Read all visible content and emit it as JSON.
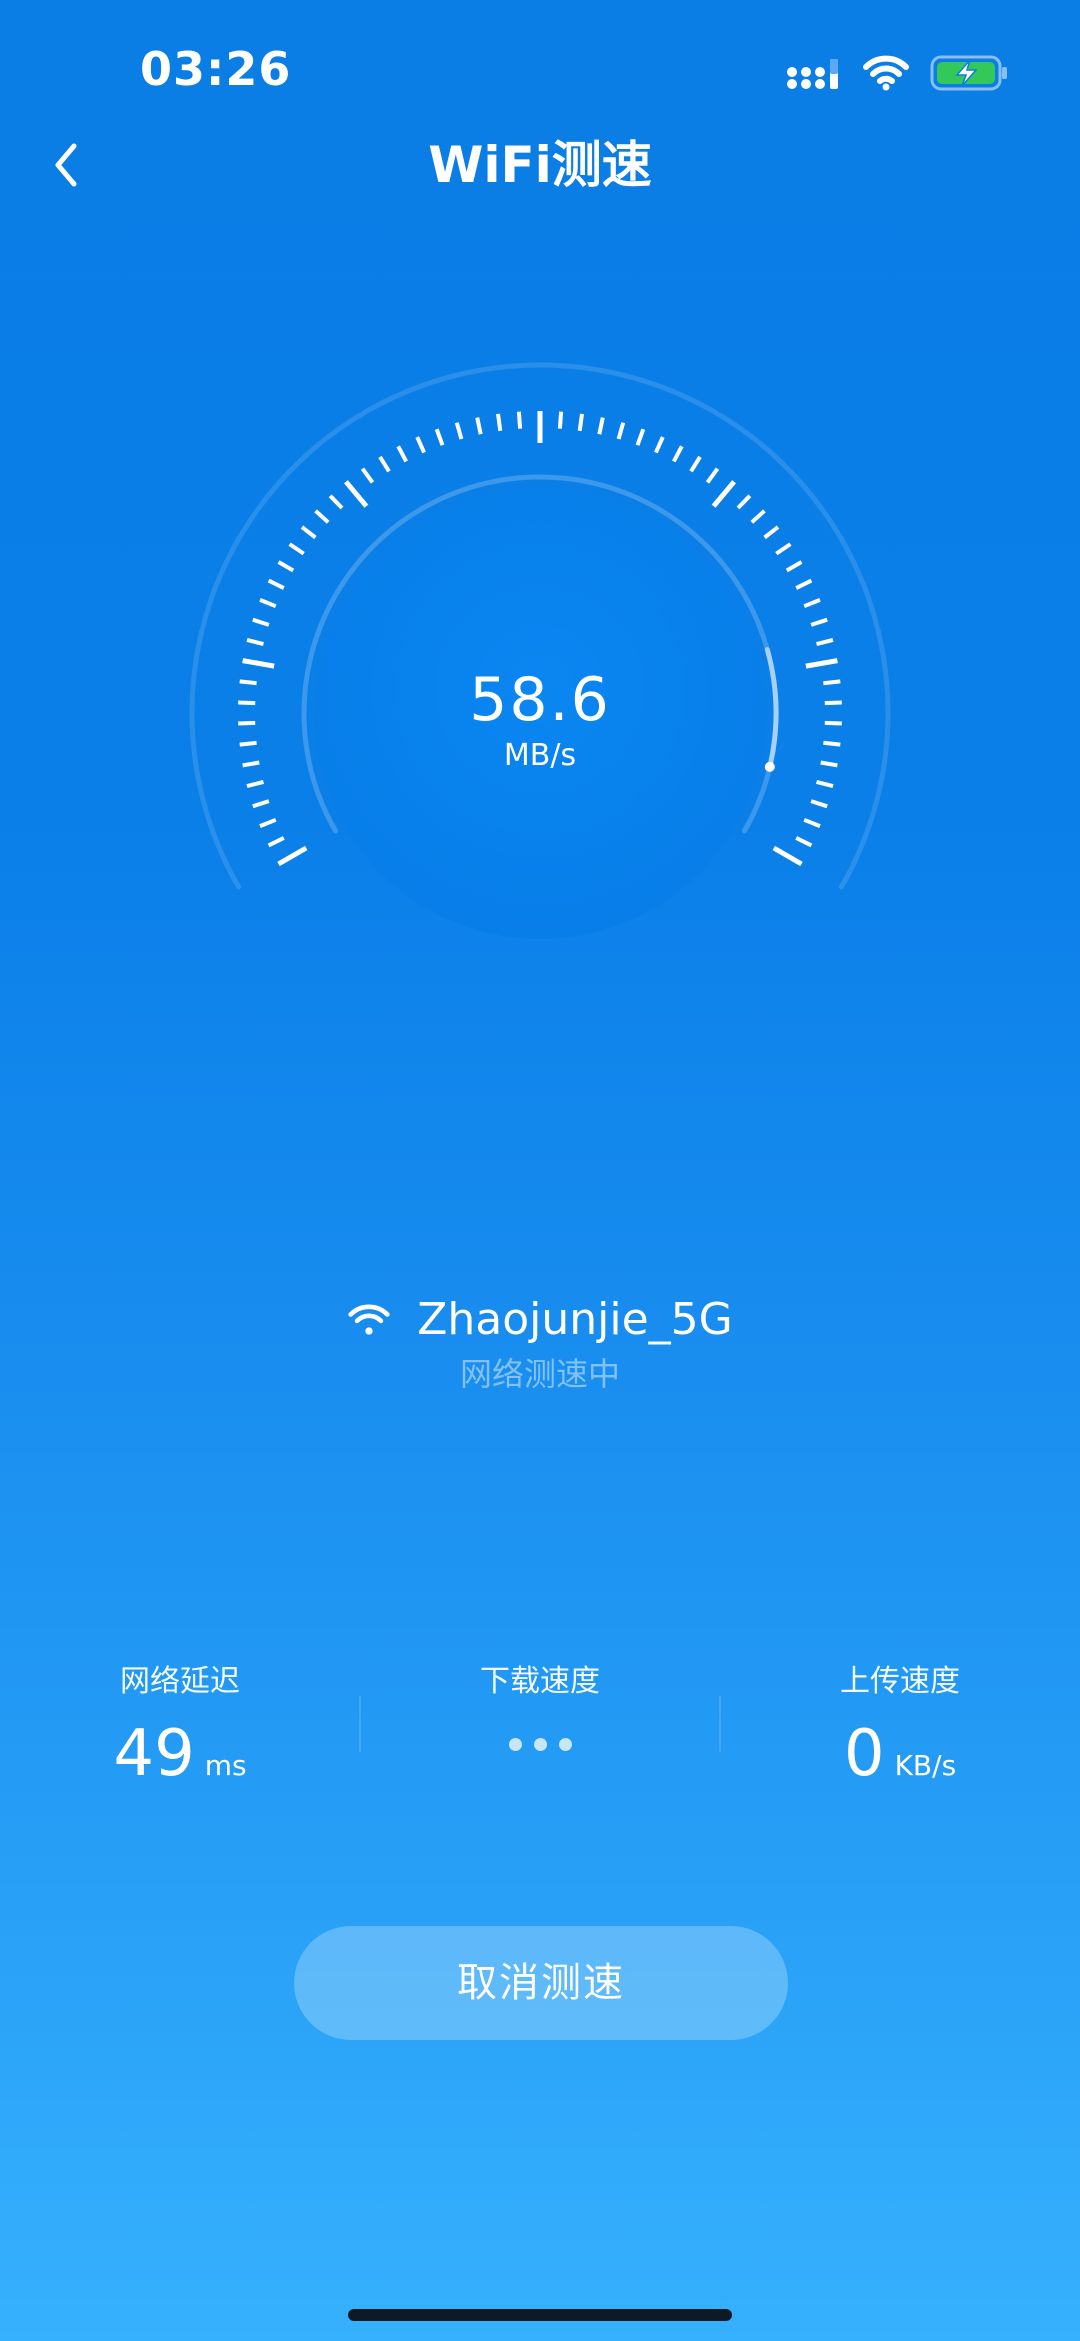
{
  "status_bar": {
    "time": "03:26"
  },
  "header": {
    "title": "WiFi测速"
  },
  "gauge": {
    "value": "58.6",
    "unit": "MB/s",
    "progress": 0.93
  },
  "network": {
    "name": "Zhaojunjie_5G",
    "status": "网络测速中"
  },
  "stats": {
    "latency": {
      "label": "网络延迟",
      "value": "49",
      "unit": "ms"
    },
    "download": {
      "label": "下载速度"
    },
    "upload": {
      "label": "上传速度",
      "value": "0",
      "unit": "KB/s"
    }
  },
  "actions": {
    "cancel_label": "取消测速"
  },
  "colors": {
    "background_top": "#0b7ee6",
    "background_bottom": "#36b1fd",
    "battery_fill": "#34c759"
  }
}
